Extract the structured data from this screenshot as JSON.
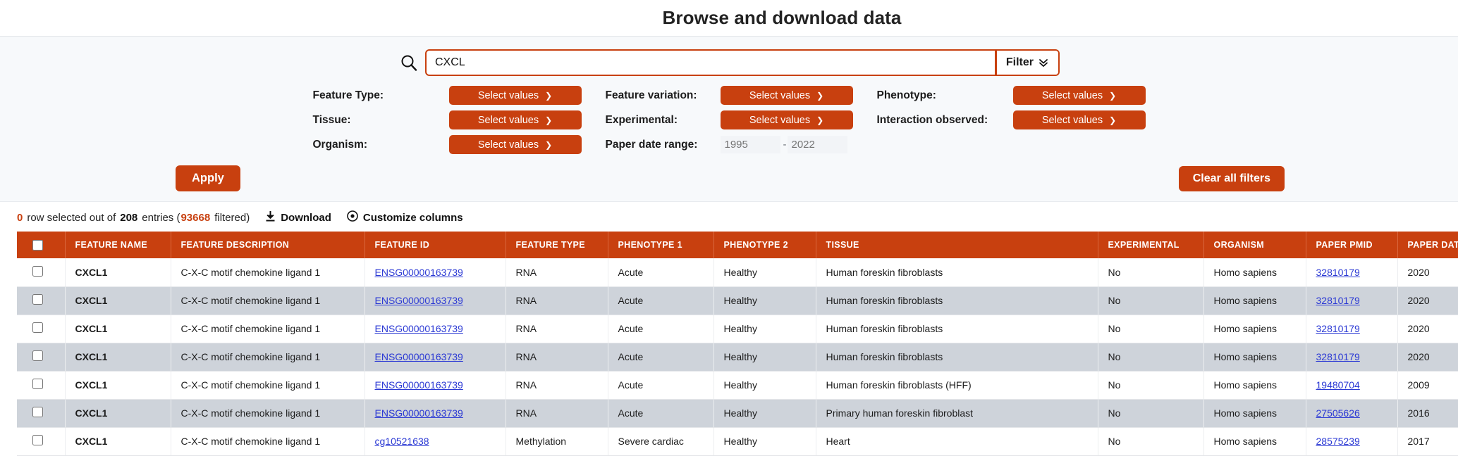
{
  "header": {
    "title": "Browse and download data"
  },
  "search": {
    "icon": "search-icon",
    "value": "CXCL",
    "placeholder": "",
    "filter_label": "Filter",
    "filter_icon": "chevron-double-down-icon"
  },
  "filters": {
    "feature_type": {
      "label": "Feature Type:",
      "value": "Select values"
    },
    "feature_variation": {
      "label": "Feature variation:",
      "value": "Select values"
    },
    "phenotype": {
      "label": "Phenotype:",
      "value": "Select values"
    },
    "tissue": {
      "label": "Tissue:",
      "value": "Select values"
    },
    "experimental": {
      "label": "Experimental:",
      "value": "Select values"
    },
    "interaction_observed": {
      "label": "Interaction observed:",
      "value": "Select values"
    },
    "organism": {
      "label": "Organism:",
      "value": "Select values"
    },
    "paper_date_range": {
      "label": "Paper date range:",
      "from_placeholder": "1995",
      "from_value": "",
      "dash": "-",
      "to_placeholder": "2022",
      "to_value": ""
    },
    "apply_label": "Apply",
    "clear_label": "Clear all filters"
  },
  "status": {
    "selected_count": "0",
    "text_1": "row selected out of",
    "entries_count": "208",
    "text_2": "entries (",
    "filtered_count": "93668",
    "text_3": "filtered)",
    "download_label": "Download",
    "download_icon": "download-icon",
    "customize_label": "Customize columns",
    "customize_icon": "eye-icon"
  },
  "table": {
    "columns": [
      "FEATURE NAME",
      "FEATURE DESCRIPTION",
      "FEATURE ID",
      "FEATURE TYPE",
      "PHENOTYPE 1",
      "PHENOTYPE 2",
      "TISSUE",
      "EXPERIMENTAL",
      "ORGANISM",
      "PAPER PMID",
      "PAPER DATE"
    ],
    "rows": [
      {
        "feature_name": "CXCL1",
        "feature_description": "C-X-C motif chemokine ligand 1",
        "feature_id": "ENSG00000163739",
        "feature_type": "RNA",
        "phenotype_1": "Acute",
        "phenotype_2": "Healthy",
        "tissue": "Human foreskin fibroblasts",
        "experimental": "No",
        "organism": "Homo sapiens",
        "paper_pmid": "32810179",
        "paper_date": "2020"
      },
      {
        "feature_name": "CXCL1",
        "feature_description": "C-X-C motif chemokine ligand 1",
        "feature_id": "ENSG00000163739",
        "feature_type": "RNA",
        "phenotype_1": "Acute",
        "phenotype_2": "Healthy",
        "tissue": "Human foreskin fibroblasts",
        "experimental": "No",
        "organism": "Homo sapiens",
        "paper_pmid": "32810179",
        "paper_date": "2020"
      },
      {
        "feature_name": "CXCL1",
        "feature_description": "C-X-C motif chemokine ligand 1",
        "feature_id": "ENSG00000163739",
        "feature_type": "RNA",
        "phenotype_1": "Acute",
        "phenotype_2": "Healthy",
        "tissue": "Human foreskin fibroblasts",
        "experimental": "No",
        "organism": "Homo sapiens",
        "paper_pmid": "32810179",
        "paper_date": "2020"
      },
      {
        "feature_name": "CXCL1",
        "feature_description": "C-X-C motif chemokine ligand 1",
        "feature_id": "ENSG00000163739",
        "feature_type": "RNA",
        "phenotype_1": "Acute",
        "phenotype_2": "Healthy",
        "tissue": "Human foreskin fibroblasts",
        "experimental": "No",
        "organism": "Homo sapiens",
        "paper_pmid": "32810179",
        "paper_date": "2020"
      },
      {
        "feature_name": "CXCL1",
        "feature_description": "C-X-C motif chemokine ligand 1",
        "feature_id": "ENSG00000163739",
        "feature_type": "RNA",
        "phenotype_1": "Acute",
        "phenotype_2": "Healthy",
        "tissue": "Human foreskin fibroblasts (HFF)",
        "experimental": "No",
        "organism": "Homo sapiens",
        "paper_pmid": "19480704",
        "paper_date": "2009"
      },
      {
        "feature_name": "CXCL1",
        "feature_description": "C-X-C motif chemokine ligand 1",
        "feature_id": "ENSG00000163739",
        "feature_type": "RNA",
        "phenotype_1": "Acute",
        "phenotype_2": "Healthy",
        "tissue": "Primary human foreskin fibroblast",
        "experimental": "No",
        "organism": "Homo sapiens",
        "paper_pmid": "27505626",
        "paper_date": "2016"
      },
      {
        "feature_name": "CXCL1",
        "feature_description": "C-X-C motif chemokine ligand 1",
        "feature_id": "cg10521638",
        "feature_type": "Methylation",
        "phenotype_1": "Severe cardiac",
        "phenotype_2": "Healthy",
        "tissue": "Heart",
        "experimental": "No",
        "organism": "Homo sapiens",
        "paper_pmid": "28575239",
        "paper_date": "2017"
      }
    ]
  },
  "colors": {
    "accent": "#c8400f",
    "link": "#2b39d4",
    "panel_bg": "#f7f9fb",
    "row_alt": "#ced3da"
  }
}
